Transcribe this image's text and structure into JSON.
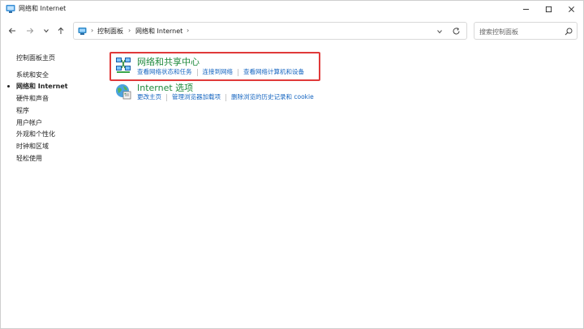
{
  "window": {
    "title": "网络和 Internet"
  },
  "address": {
    "breadcrumbs": [
      "控制面板",
      "网络和 Internet"
    ]
  },
  "search": {
    "placeholder": "搜索控制面板"
  },
  "sidebar": {
    "items": [
      {
        "label": "控制面板主页"
      },
      {
        "label": "系统和安全"
      },
      {
        "label": "网络和 Internet"
      },
      {
        "label": "硬件和声音"
      },
      {
        "label": "程序"
      },
      {
        "label": "用户帐户"
      },
      {
        "label": "外观和个性化"
      },
      {
        "label": "时钟和区域"
      },
      {
        "label": "轻松使用"
      }
    ]
  },
  "categories": [
    {
      "title": "网络和共享中心",
      "icon": "network-sharing-center-icon",
      "links": [
        "查看网络状态和任务",
        "连接到网络",
        "查看网络计算机和设备"
      ]
    },
    {
      "title": "Internet 选项",
      "icon": "internet-options-globe-icon",
      "links": [
        "更改主页",
        "管理浏览器加载项",
        "删除浏览的历史记录和 cookie"
      ]
    }
  ],
  "colors": {
    "category_title": "#1f8a3c",
    "link": "#1565c0",
    "highlight_border": "#e03a3a"
  }
}
